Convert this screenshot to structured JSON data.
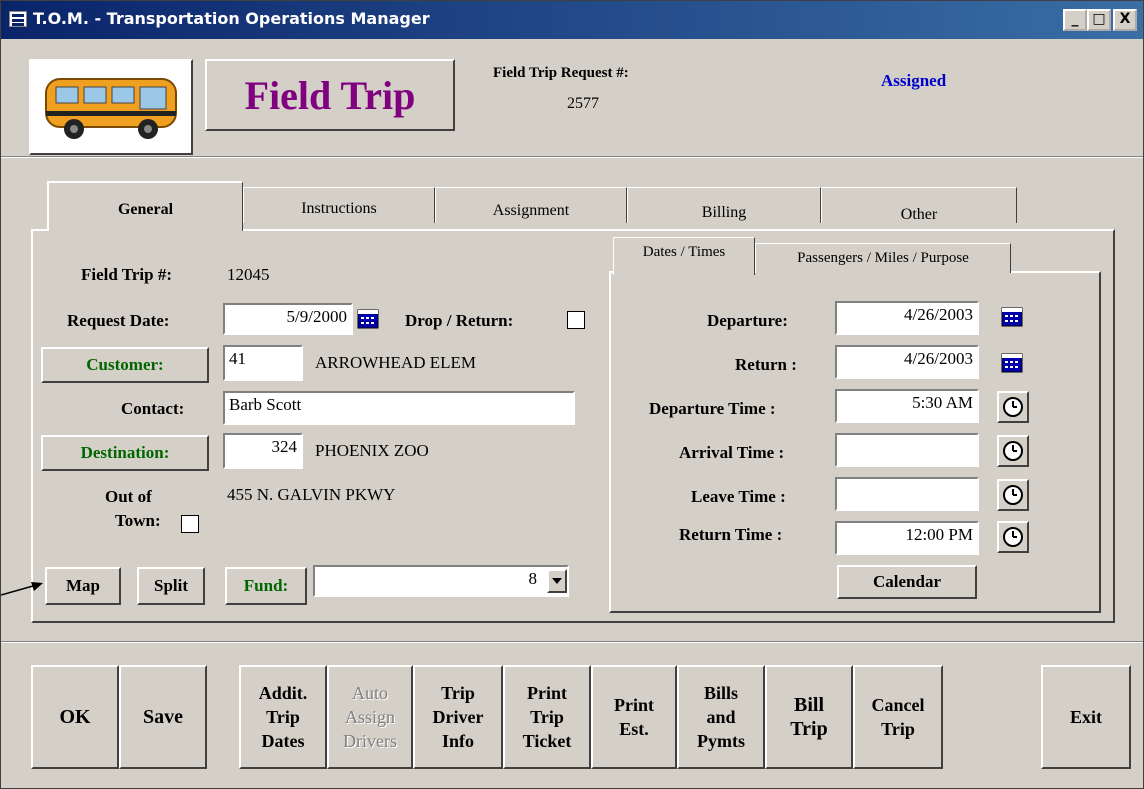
{
  "window": {
    "title": "T.O.M. - Transportation Operations Manager",
    "controls": {
      "minimize": "_",
      "maximize": "□",
      "close": "X"
    }
  },
  "header": {
    "logo_icon": "school-bus-icon",
    "title": "Field Trip",
    "request_label": "Field Trip Request #:",
    "request_value": "2577",
    "status": "Assigned",
    "status_color": "#0000cc",
    "title_color": "#800080"
  },
  "tabs": [
    "General",
    "Instructions",
    "Assignment",
    "Billing",
    "Other"
  ],
  "general": {
    "trip_num_label": "Field Trip #:",
    "trip_num_value": "12045",
    "request_date_label": "Request Date:",
    "request_date_value": "5/9/2000",
    "drop_return_label": "Drop / Return:",
    "customer_button": "Customer:",
    "customer_code": "41",
    "customer_name": "ARROWHEAD ELEM",
    "contact_label": "Contact:",
    "contact_value": "Barb Scott",
    "destination_button": "Destination:",
    "destination_code": "324",
    "destination_name": "PHOENIX ZOO",
    "out_of_town_label_1": "Out of",
    "out_of_town_label_2": "Town:",
    "destination_address": "455 N. GALVIN PKWY",
    "map_button": "Map",
    "split_button": "Split",
    "fund_button": "Fund:",
    "fund_value": "8"
  },
  "subtabs": [
    "Dates / Times",
    "Passengers / Miles / Purpose"
  ],
  "dates": {
    "departure_label": "Departure:",
    "departure_value": "4/26/2003",
    "return_label": "Return :",
    "return_value": "4/26/2003",
    "departure_time_label": "Departure Time :",
    "departure_time_value": "5:30 AM",
    "arrival_time_label": "Arrival Time :",
    "arrival_time_value": "",
    "leave_time_label": "Leave Time :",
    "leave_time_value": "",
    "return_time_label": "Return Time :",
    "return_time_value": "12:00 PM",
    "calendar_button": "Calendar"
  },
  "bottom_buttons": {
    "ok": "OK",
    "save": "Save",
    "addit_trip_dates": "Addit.\nTrip\nDates",
    "auto_assign_drivers": "Auto\nAssign\nDrivers",
    "trip_driver_info": "Trip\nDriver\nInfo",
    "print_trip_ticket": "Print\nTrip\nTicket",
    "print_est": "Print\nEst.",
    "bills_and_pymts": "Bills\nand\nPymts",
    "bill_trip": "Bill\nTrip",
    "cancel_trip": "Cancel\nTrip",
    "exit": "Exit"
  }
}
